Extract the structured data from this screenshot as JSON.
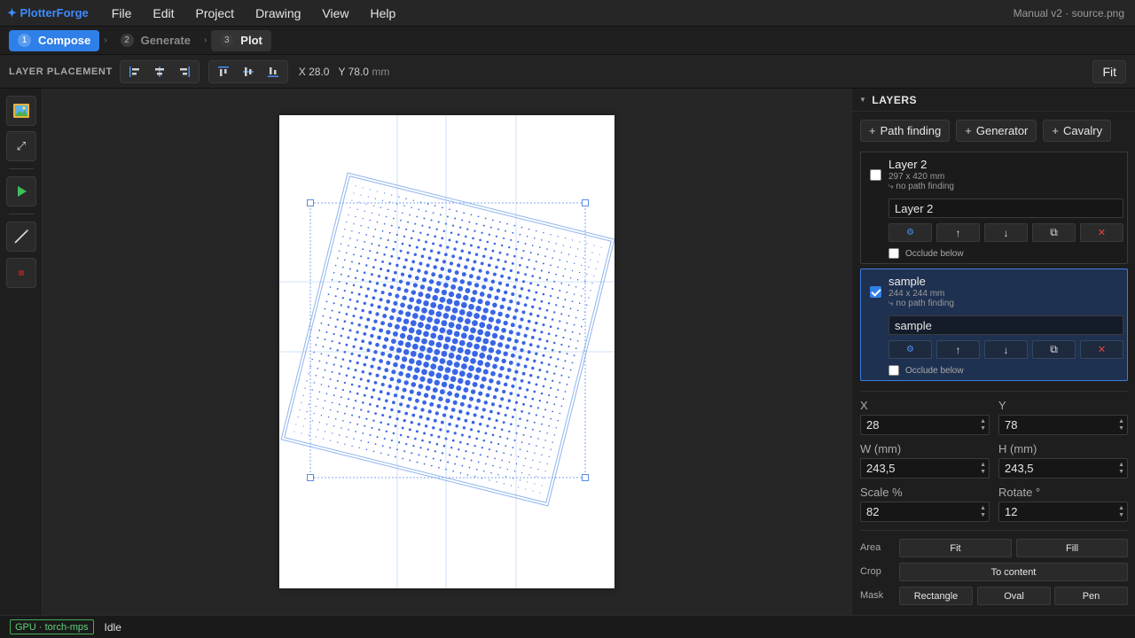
{
  "app": {
    "brand": "✦ PlotterForge",
    "window_title": "Manual v2 · source.png"
  },
  "menu": [
    "File",
    "Edit",
    "Project",
    "Drawing",
    "View",
    "Help"
  ],
  "steps": [
    {
      "num": "1",
      "label": "Compose",
      "state": "active"
    },
    {
      "num": "2",
      "label": "Generate",
      "state": "inactive"
    },
    {
      "num": "3",
      "label": "Plot",
      "state": "current"
    }
  ],
  "step_separator": "›",
  "toolbar": {
    "label": "LAYER PLACEMENT",
    "x_readout": "X 28.0",
    "y_readout": "Y 78.0",
    "unit": "mm",
    "fit_label": "Fit"
  },
  "left_tools": [
    {
      "name": "image-icon"
    },
    {
      "name": "expand-icon",
      "glyph": "⤢"
    },
    {
      "name": "play-icon"
    },
    {
      "name": "pen-icon"
    },
    {
      "name": "stop-icon"
    }
  ],
  "layers_panel": {
    "title": "LAYERS",
    "add_buttons": [
      "Path finding",
      "Generator",
      "Cavalry"
    ],
    "layers": [
      {
        "name": "Layer 2",
        "dims": "297 x 420 mm",
        "path": "⤷ no path finding",
        "input_value": "Layer 2",
        "checked": false,
        "occlude_label": "Occlude below"
      },
      {
        "name": "sample",
        "dims": "244 x 244 mm",
        "path": "⤷ no path finding",
        "input_value": "sample",
        "checked": true,
        "occlude_label": "Occlude below"
      }
    ],
    "layer_action_glyphs": [
      "⚙",
      "↑",
      "↓",
      "⧉",
      "✕"
    ]
  },
  "properties": {
    "x": {
      "label": "X",
      "value": "28"
    },
    "y": {
      "label": "Y",
      "value": "78"
    },
    "w": {
      "label": "W (mm)",
      "value": "243,5"
    },
    "h": {
      "label": "H (mm)",
      "value": "243,5"
    },
    "scale": {
      "label": "Scale %",
      "value": "82"
    },
    "rotate": {
      "label": "Rotate °",
      "value": "12"
    }
  },
  "area": {
    "label": "Area",
    "fit": "Fit",
    "fill": "Fill"
  },
  "crop": {
    "label": "Crop",
    "to_content": "To content"
  },
  "mask": {
    "label": "Mask",
    "rectangle": "Rectangle",
    "oval": "Oval",
    "pen": "Pen"
  },
  "status": {
    "gpu": "GPU · torch-mps",
    "state": "Idle"
  },
  "colors": {
    "accent": "#2f7fe8",
    "dots": "#3a66e6",
    "gpu_badge": "#3fae5a",
    "delete": "#e04545"
  }
}
